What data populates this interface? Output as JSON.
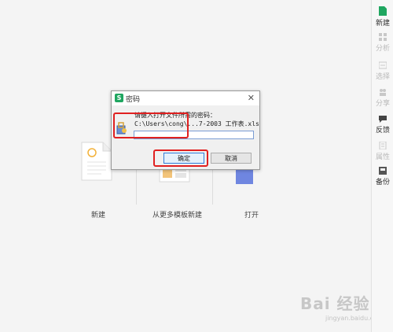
{
  "sidebar": {
    "items": [
      {
        "label": "新建",
        "state": "active"
      },
      {
        "label": "分析",
        "state": "disabled"
      },
      {
        "label": "选择",
        "state": "disabled"
      },
      {
        "label": "分享",
        "state": "disabled"
      },
      {
        "label": "反馈",
        "state": "active"
      },
      {
        "label": "属性",
        "state": "disabled"
      },
      {
        "label": "备份",
        "state": "active"
      }
    ]
  },
  "launcher": {
    "new_label": "新建",
    "template_label": "从更多模板新建",
    "open_label": "打开"
  },
  "dialog": {
    "title": "密码",
    "prompt": "请键入打开文件所需的密码：",
    "path": "C:\\Users\\cong\\...7-2003 工作表.xls",
    "password_value": "",
    "ok_label": "确定",
    "cancel_label": "取消",
    "close_glyph": "✕",
    "app_icon_letter": "S"
  },
  "watermark": {
    "text": "Bai 经验",
    "sub": "jingyan.baidu.com"
  },
  "colors": {
    "accent_green": "#1fa660",
    "highlight_red": "#e02020",
    "focus_blue": "#2f7bd9"
  }
}
